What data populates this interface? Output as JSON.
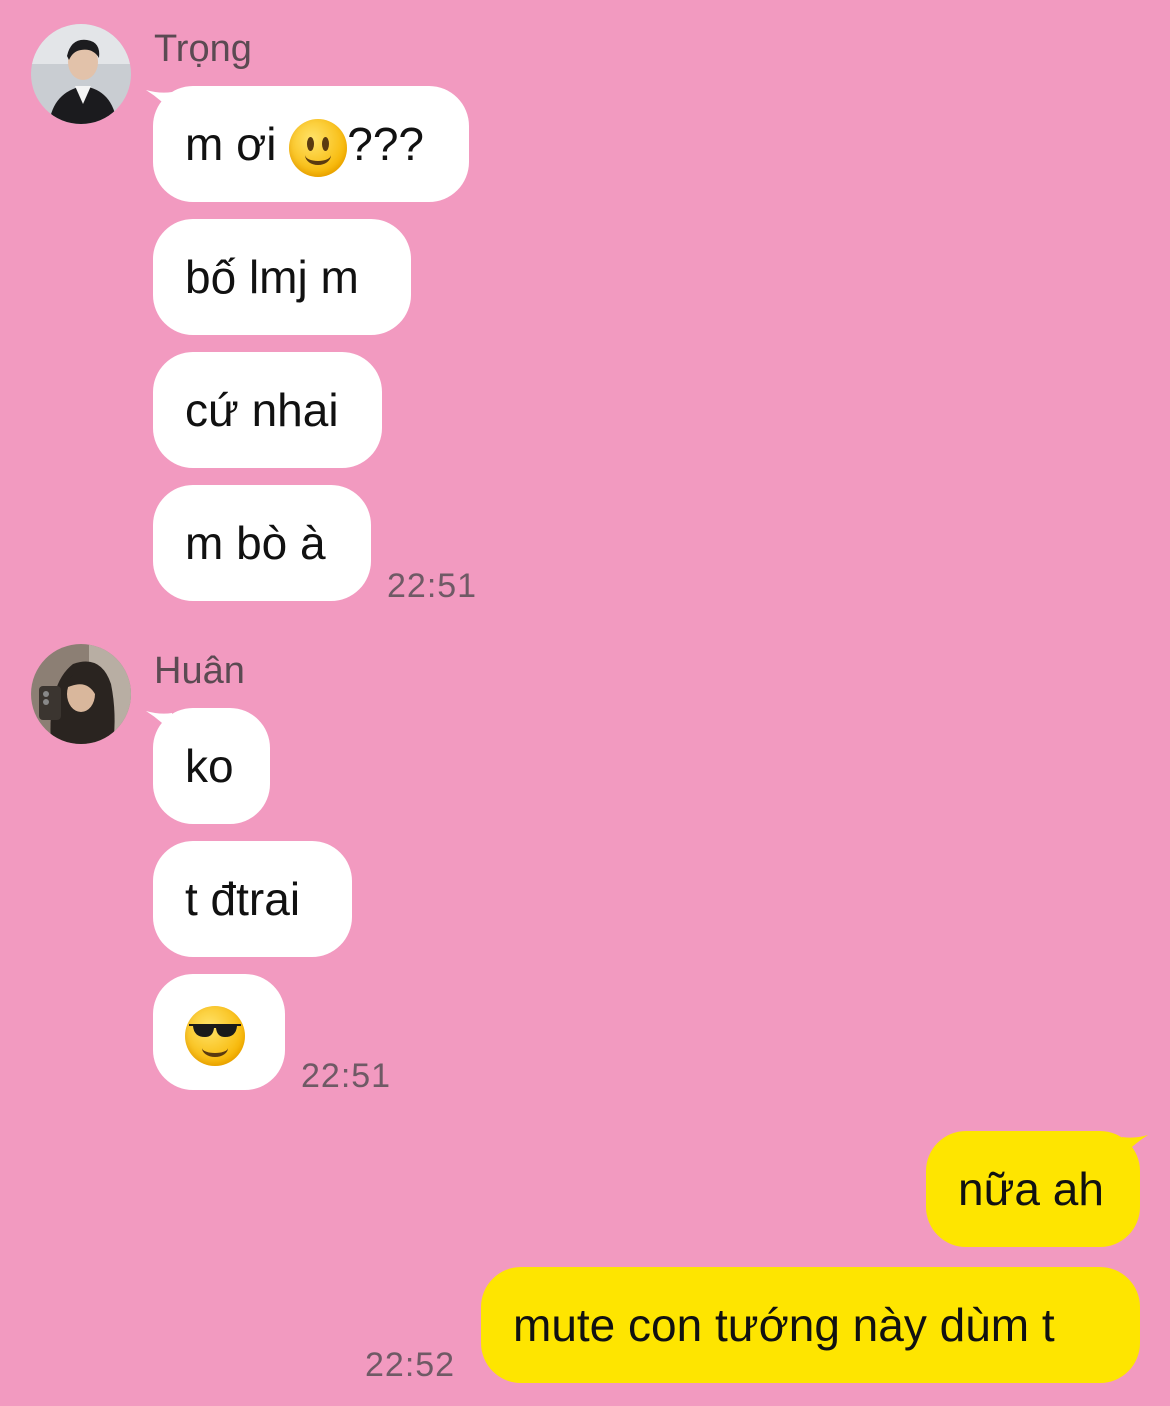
{
  "colors": {
    "background": "#f29ac0",
    "incoming_bubble": "#ffffff",
    "outgoing_bubble": "#fee500"
  },
  "groups": [
    {
      "sender": "Trọng",
      "avatar_icon": "avatar-photo",
      "messages": [
        "m ơi",
        "???",
        "bố lmj m",
        "cứ nhai",
        "m bò à"
      ],
      "time": "22:51"
    },
    {
      "sender": "Huân",
      "avatar_icon": "avatar-photo",
      "messages": [
        "ko",
        "t đtrai",
        "smiling-face-with-sunglasses"
      ],
      "time": "22:51"
    }
  ],
  "outgoing": {
    "messages": [
      "nữa ah",
      "mute con tướng này dùm t"
    ],
    "time": "22:52"
  }
}
